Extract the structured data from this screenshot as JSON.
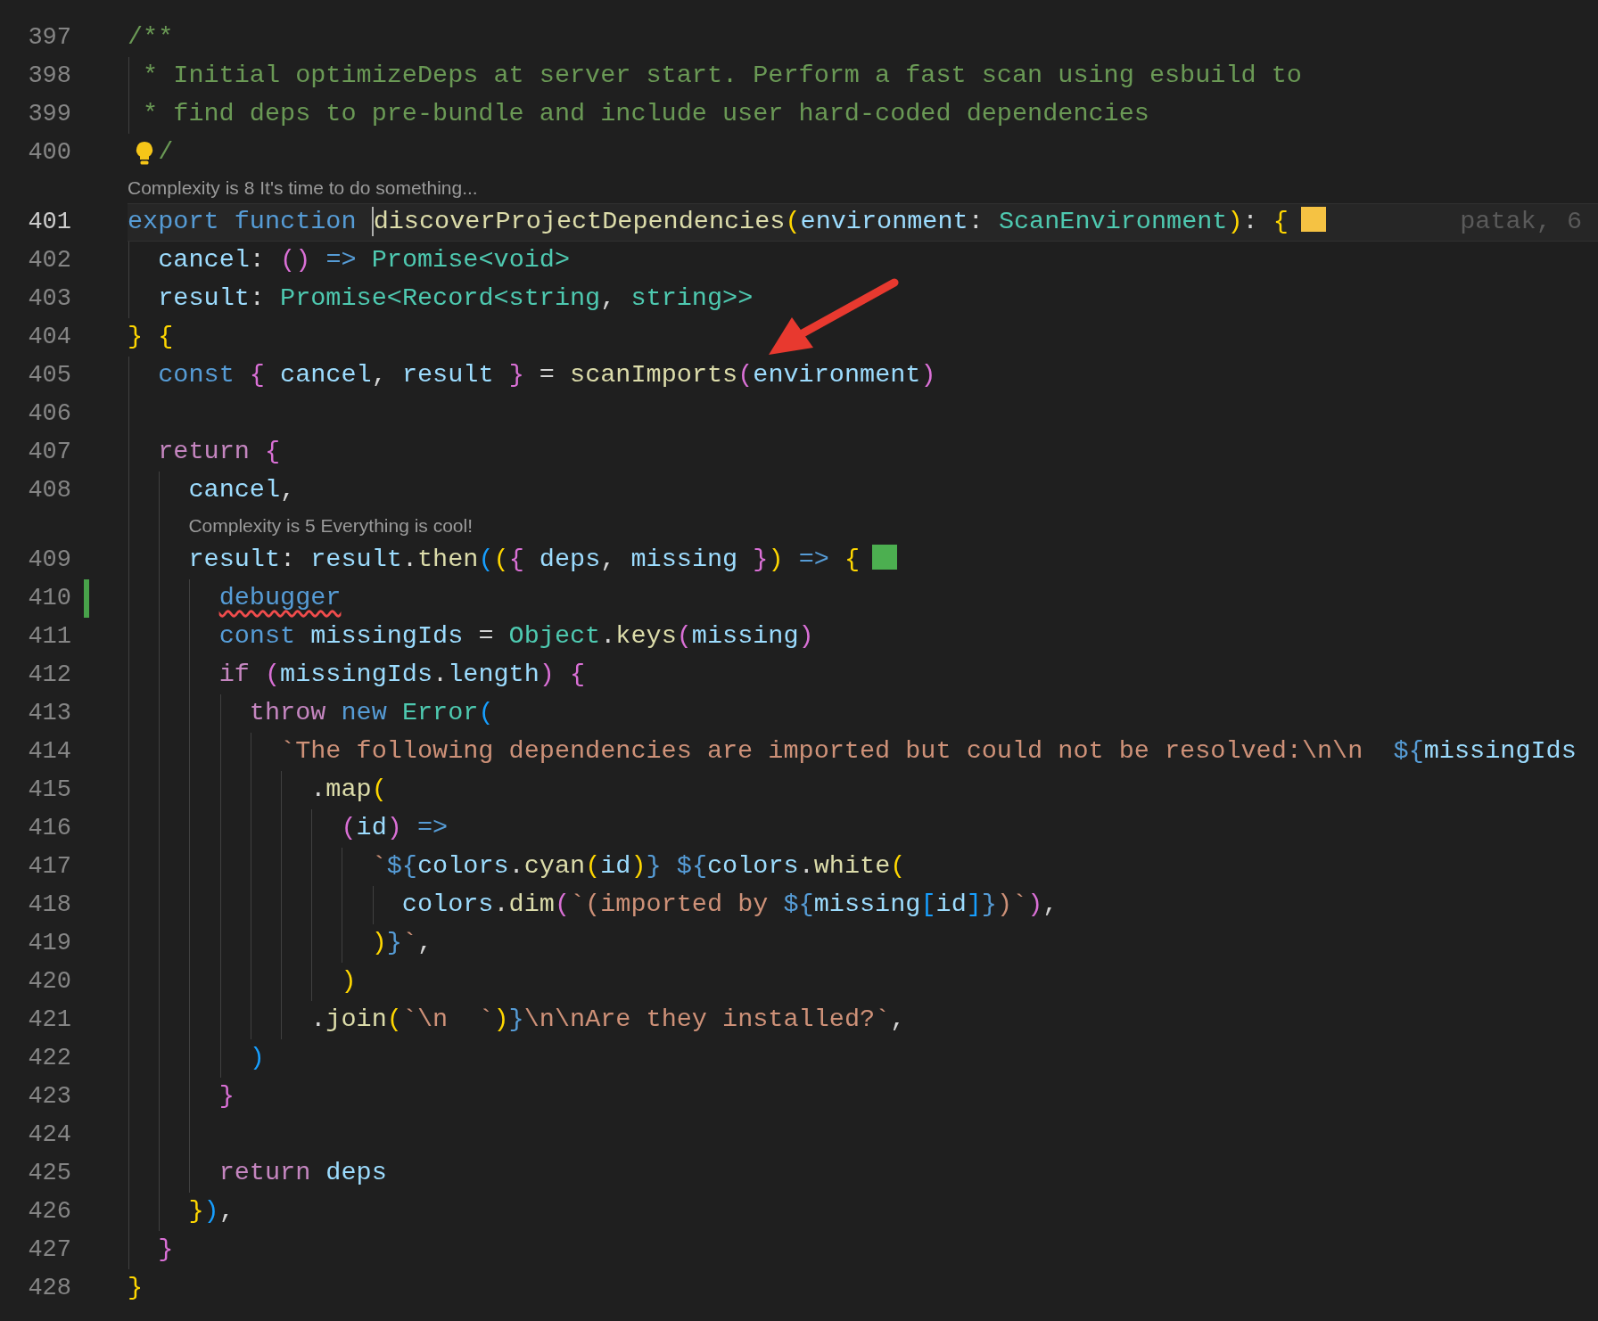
{
  "lines": [
    {
      "kind": "code",
      "number": "397",
      "current": false,
      "tokens": [
        {
          "kind": "comment",
          "text": "/**"
        }
      ]
    },
    {
      "kind": "code",
      "number": "398",
      "current": false,
      "tokens": [
        {
          "kind": "comment",
          "text": " * Initial optimizeDeps at server start. Perform a fast scan using esbuild to"
        }
      ]
    },
    {
      "kind": "code",
      "number": "399",
      "current": false,
      "tokens": [
        {
          "kind": "comment",
          "text": " * find deps to pre-bundle and include user hard-coded dependencies"
        }
      ]
    },
    {
      "kind": "code",
      "number": "400",
      "current": false,
      "lightbulb": true,
      "tokens": [
        {
          "kind": "comment",
          "text": "  /"
        }
      ]
    },
    {
      "kind": "lens",
      "text": "Complexity is 8 It's time to do something..."
    },
    {
      "kind": "code",
      "number": "401",
      "current": true,
      "color": "#f5c243",
      "blame": "patak, 6",
      "tokens": [
        {
          "kind": "kw",
          "text": "export function "
        },
        {
          "kind": "fn",
          "text": "discoverProjectDependencies",
          "cursor": true
        },
        {
          "kind": "b1",
          "text": "("
        },
        {
          "kind": "var",
          "text": "environment"
        },
        {
          "kind": "p",
          "text": ": "
        },
        {
          "kind": "type",
          "text": "ScanEnvironment"
        },
        {
          "kind": "b1",
          "text": ")"
        },
        {
          "kind": "p",
          "text": ": "
        },
        {
          "kind": "b1",
          "text": "{"
        }
      ]
    },
    {
      "kind": "code",
      "number": "402",
      "current": false,
      "tokens": [
        {
          "kind": "var",
          "text": "  cancel"
        },
        {
          "kind": "p",
          "text": ": "
        },
        {
          "kind": "b2",
          "text": "()"
        },
        {
          "kind": "kw",
          "text": " => "
        },
        {
          "kind": "type",
          "text": "Promise<void>"
        }
      ]
    },
    {
      "kind": "code",
      "number": "403",
      "current": false,
      "tokens": [
        {
          "kind": "var",
          "text": "  result"
        },
        {
          "kind": "p",
          "text": ": "
        },
        {
          "kind": "type",
          "text": "Promise<Record<string"
        },
        {
          "kind": "p",
          "text": ", "
        },
        {
          "kind": "type",
          "text": "string>>"
        }
      ]
    },
    {
      "kind": "code",
      "number": "404",
      "current": false,
      "tokens": [
        {
          "kind": "b1",
          "text": "}"
        },
        {
          "kind": "b1",
          "text": " {"
        }
      ]
    },
    {
      "kind": "code",
      "number": "405",
      "current": false,
      "tokens": [
        {
          "kind": "kw",
          "text": "  const "
        },
        {
          "kind": "b2",
          "text": "{ "
        },
        {
          "kind": "var",
          "text": "cancel"
        },
        {
          "kind": "p",
          "text": ", "
        },
        {
          "kind": "var",
          "text": "result "
        },
        {
          "kind": "b2",
          "text": "}"
        },
        {
          "kind": "p",
          "text": " = "
        },
        {
          "kind": "fn",
          "text": "scanImports"
        },
        {
          "kind": "b2",
          "text": "("
        },
        {
          "kind": "var",
          "text": "environment"
        },
        {
          "kind": "b2",
          "text": ")"
        }
      ]
    },
    {
      "kind": "code",
      "number": "406",
      "current": false
    },
    {
      "kind": "code",
      "number": "407",
      "current": false,
      "tokens": [
        {
          "kind": "ctrl",
          "text": "  return "
        },
        {
          "kind": "b2",
          "text": "{"
        }
      ]
    },
    {
      "kind": "code",
      "number": "408",
      "current": false,
      "tokens": [
        {
          "kind": "var",
          "text": "    cancel"
        },
        {
          "kind": "p",
          "text": ","
        }
      ]
    },
    {
      "kind": "lens",
      "text": "Complexity is 5 Everything is cool!"
    },
    {
      "kind": "code",
      "number": "409",
      "current": false,
      "color": "#4caf50",
      "tokens": [
        {
          "kind": "var",
          "text": "    result"
        },
        {
          "kind": "p",
          "text": ": "
        },
        {
          "kind": "var",
          "text": "result"
        },
        {
          "kind": "p",
          "text": "."
        },
        {
          "kind": "fn",
          "text": "then"
        },
        {
          "kind": "b3",
          "text": "("
        },
        {
          "kind": "b1",
          "text": "("
        },
        {
          "kind": "b2",
          "text": "{ "
        },
        {
          "kind": "var",
          "text": "deps"
        },
        {
          "kind": "p",
          "text": ", "
        },
        {
          "kind": "var",
          "text": "missing "
        },
        {
          "kind": "b2",
          "text": "}"
        },
        {
          "kind": "b1",
          "text": ")"
        },
        {
          "kind": "kw",
          "text": " => "
        },
        {
          "kind": "b1",
          "text": "{"
        }
      ]
    },
    {
      "kind": "code",
      "number": "410",
      "current": false,
      "git_added": true,
      "tokens": [
        {
          "kind": "kw",
          "text": "      debugger",
          "error": true
        }
      ]
    },
    {
      "kind": "code",
      "number": "411",
      "current": false,
      "tokens": [
        {
          "kind": "kw",
          "text": "      const "
        },
        {
          "kind": "var",
          "text": "missingIds"
        },
        {
          "kind": "p",
          "text": " = "
        },
        {
          "kind": "type",
          "text": "Object"
        },
        {
          "kind": "p",
          "text": "."
        },
        {
          "kind": "fn",
          "text": "keys"
        },
        {
          "kind": "b2",
          "text": "("
        },
        {
          "kind": "var",
          "text": "missing"
        },
        {
          "kind": "b2",
          "text": ")"
        }
      ]
    },
    {
      "kind": "code",
      "number": "412",
      "current": false,
      "tokens": [
        {
          "kind": "ctrl",
          "text": "      if "
        },
        {
          "kind": "b2",
          "text": "("
        },
        {
          "kind": "var",
          "text": "missingIds"
        },
        {
          "kind": "p",
          "text": "."
        },
        {
          "kind": "var",
          "text": "length"
        },
        {
          "kind": "b2",
          "text": ")"
        },
        {
          "kind": "b2",
          "text": " {"
        }
      ]
    },
    {
      "kind": "code",
      "number": "413",
      "current": false,
      "tokens": [
        {
          "kind": "ctrl",
          "text": "        throw "
        },
        {
          "kind": "kw",
          "text": "new "
        },
        {
          "kind": "type",
          "text": "Error"
        },
        {
          "kind": "b3",
          "text": "("
        }
      ]
    },
    {
      "kind": "code",
      "number": "414",
      "current": false,
      "tokens": [
        {
          "kind": "str",
          "text": "          `The following dependencies are imported but could not be resolved:\\n\\n  "
        },
        {
          "kind": "kw",
          "text": "${"
        },
        {
          "kind": "var",
          "text": "missingIds"
        }
      ]
    },
    {
      "kind": "code",
      "number": "415",
      "current": false,
      "tokens": [
        {
          "kind": "p",
          "text": "            ."
        },
        {
          "kind": "fn",
          "text": "map"
        },
        {
          "kind": "b1",
          "text": "("
        }
      ]
    },
    {
      "kind": "code",
      "number": "416",
      "current": false,
      "tokens": [
        {
          "kind": "b2",
          "text": "              ("
        },
        {
          "kind": "var",
          "text": "id"
        },
        {
          "kind": "b2",
          "text": ")"
        },
        {
          "kind": "kw",
          "text": " =>"
        }
      ]
    },
    {
      "kind": "code",
      "number": "417",
      "current": false,
      "tokens": [
        {
          "kind": "str",
          "text": "                `"
        },
        {
          "kind": "kw",
          "text": "${"
        },
        {
          "kind": "var",
          "text": "colors"
        },
        {
          "kind": "p",
          "text": "."
        },
        {
          "kind": "fn",
          "text": "cyan"
        },
        {
          "kind": "b1",
          "text": "("
        },
        {
          "kind": "var",
          "text": "id"
        },
        {
          "kind": "b1",
          "text": ")"
        },
        {
          "kind": "kw",
          "text": "}"
        },
        {
          "kind": "kw",
          "text": " ${"
        },
        {
          "kind": "var",
          "text": "colors"
        },
        {
          "kind": "p",
          "text": "."
        },
        {
          "kind": "fn",
          "text": "white"
        },
        {
          "kind": "b1",
          "text": "("
        }
      ]
    },
    {
      "kind": "code",
      "number": "418",
      "current": false,
      "tokens": [
        {
          "kind": "var",
          "text": "                  colors"
        },
        {
          "kind": "p",
          "text": "."
        },
        {
          "kind": "fn",
          "text": "dim"
        },
        {
          "kind": "b2",
          "text": "("
        },
        {
          "kind": "str",
          "text": "`(imported by "
        },
        {
          "kind": "kw",
          "text": "${"
        },
        {
          "kind": "var",
          "text": "missing"
        },
        {
          "kind": "b3",
          "text": "["
        },
        {
          "kind": "var",
          "text": "id"
        },
        {
          "kind": "b3",
          "text": "]"
        },
        {
          "kind": "kw",
          "text": "}"
        },
        {
          "kind": "str",
          "text": ")`"
        },
        {
          "kind": "b2",
          "text": ")"
        },
        {
          "kind": "p",
          "text": ","
        }
      ]
    },
    {
      "kind": "code",
      "number": "419",
      "current": false,
      "tokens": [
        {
          "kind": "b1",
          "text": "                )"
        },
        {
          "kind": "kw",
          "text": "}"
        },
        {
          "kind": "str",
          "text": "`"
        },
        {
          "kind": "p",
          "text": ","
        }
      ]
    },
    {
      "kind": "code",
      "number": "420",
      "current": false,
      "tokens": [
        {
          "kind": "b1",
          "text": "              )"
        }
      ]
    },
    {
      "kind": "code",
      "number": "421",
      "current": false,
      "tokens": [
        {
          "kind": "p",
          "text": "            ."
        },
        {
          "kind": "fn",
          "text": "join"
        },
        {
          "kind": "b1",
          "text": "("
        },
        {
          "kind": "str",
          "text": "`\\n  `"
        },
        {
          "kind": "b1",
          "text": ")"
        },
        {
          "kind": "kw",
          "text": "}"
        },
        {
          "kind": "str",
          "text": "\\n\\nAre they installed?`"
        },
        {
          "kind": "p",
          "text": ","
        }
      ]
    },
    {
      "kind": "code",
      "number": "422",
      "current": false,
      "tokens": [
        {
          "kind": "b3",
          "text": "        )"
        }
      ]
    },
    {
      "kind": "code",
      "number": "423",
      "current": false,
      "tokens": [
        {
          "kind": "b2",
          "text": "      }"
        }
      ]
    },
    {
      "kind": "code",
      "number": "424",
      "current": false
    },
    {
      "kind": "code",
      "number": "425",
      "current": false,
      "tokens": [
        {
          "kind": "ctrl",
          "text": "      return "
        },
        {
          "kind": "var",
          "text": "deps"
        }
      ]
    },
    {
      "kind": "code",
      "number": "426",
      "current": false,
      "tokens": [
        {
          "kind": "b1",
          "text": "    }"
        },
        {
          "kind": "b3",
          "text": ")"
        },
        {
          "kind": "p",
          "text": ","
        }
      ]
    },
    {
      "kind": "code",
      "number": "427",
      "current": false,
      "tokens": [
        {
          "kind": "b2",
          "text": "  }"
        }
      ]
    },
    {
      "kind": "code",
      "number": "428",
      "current": false,
      "tokens": [
        {
          "kind": "b1",
          "text": "}"
        }
      ]
    }
  ],
  "annotation": {
    "kind": "arrow"
  }
}
